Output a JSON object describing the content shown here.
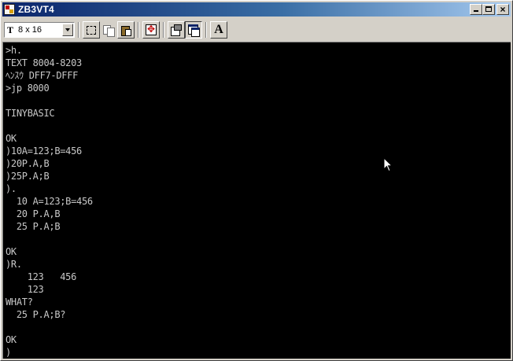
{
  "window": {
    "title": "ZB3VT4",
    "icon": "app-icon",
    "buttons": [
      "minimize-icon",
      "maximize-icon",
      "close-icon"
    ]
  },
  "toolbar": {
    "font_glyph": "T",
    "font_size": "8 x 16",
    "font_button_label": "A",
    "tools": [
      "select-icon",
      "copy-icon",
      "paste-icon",
      "move-icon",
      "properties-icon",
      "window-icon",
      "font-icon"
    ]
  },
  "terminal": {
    "lines": [
      ">h.",
      "TEXT 8004-8203",
      "ﾍﾝｽｳ DFF7-DFFF",
      ">jp 8000",
      "",
      "TINYBASIC",
      "",
      "OK",
      ")10A=123;B=456",
      ")20P.A,B",
      ")25P.A;B",
      ").",
      "  10 A=123;B=456",
      "  20 P.A,B",
      "  25 P.A;B",
      "",
      "OK",
      ")R.",
      "    123   456",
      "    123",
      "WHAT?",
      "  25 P.A;B?",
      "",
      "OK",
      ")"
    ]
  },
  "colors": {
    "title_bar_start": "#0a246a",
    "title_bar_end": "#a6caf0",
    "terminal_bg": "#000000",
    "terminal_fg": "#c8c8c8",
    "chrome": "#d4d0c8"
  }
}
